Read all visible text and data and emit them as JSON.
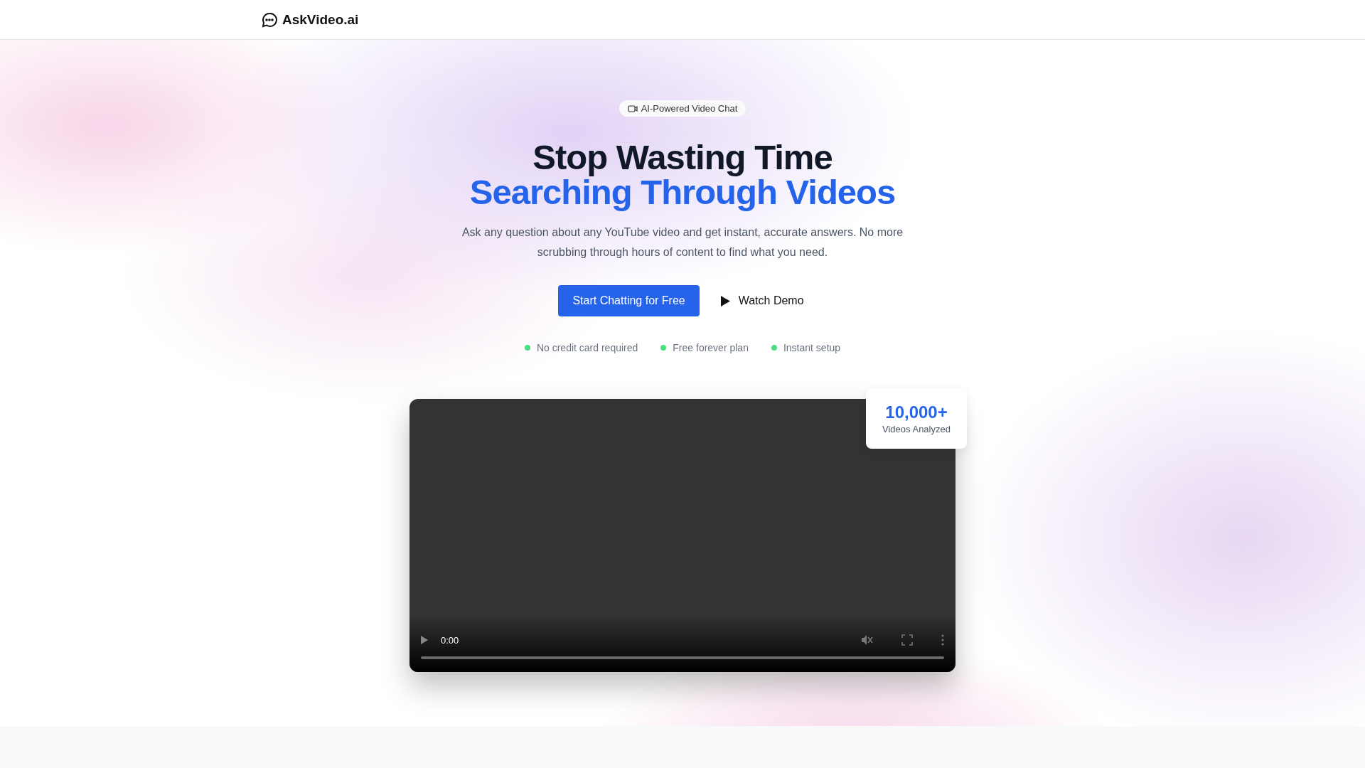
{
  "header": {
    "logo": "AskVideo.ai"
  },
  "hero": {
    "badge": "AI-Powered Video Chat",
    "title_line_1": "Stop Wasting Time",
    "title_line_2": "Searching Through Videos",
    "subtitle": "Ask any question about any YouTube video and get instant, accurate answers. No more scrubbing through hours of content to find what you need.",
    "buttons": [
      {
        "label": "Start Chatting for Free",
        "kind": "primary"
      },
      {
        "label": "Watch Demo",
        "kind": "play"
      }
    ],
    "features": [
      {
        "label": "No credit card required",
        "color": "#4ade80"
      },
      {
        "label": "Free forever plan",
        "color": "#4ade80"
      },
      {
        "label": "Instant setup",
        "color": "#4ade80"
      }
    ]
  },
  "video": {
    "time": "0:00",
    "muted": true
  },
  "stat": {
    "value": "10,000+",
    "label": "Videos Analyzed"
  }
}
